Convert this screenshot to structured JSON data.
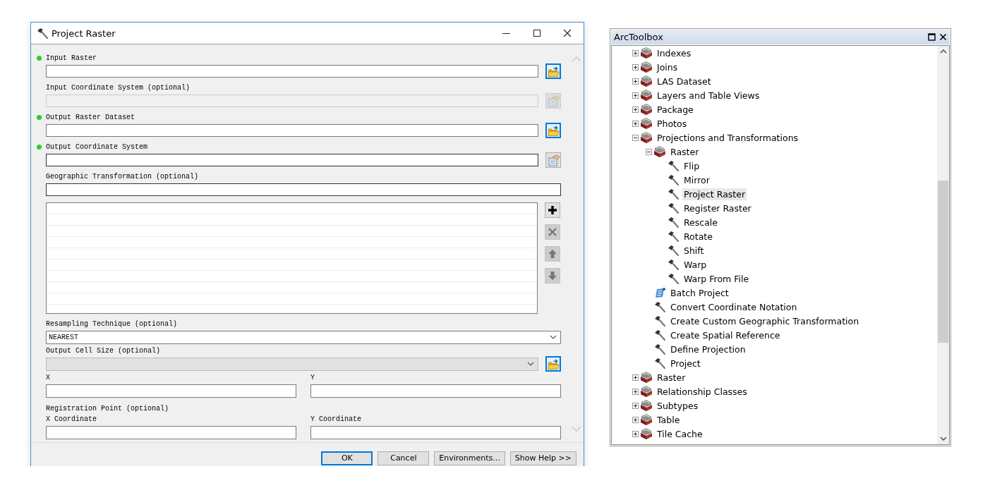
{
  "dialog": {
    "title": "Project Raster",
    "params": [
      {
        "kind": "field",
        "label": "Input Raster",
        "required": true,
        "disabled": false,
        "button": {
          "kind": "browse",
          "disabled": false
        }
      },
      {
        "kind": "field",
        "label": "Input Coordinate System (optional)",
        "required": false,
        "disabled": true,
        "button": {
          "kind": "properties",
          "disabled": true
        }
      },
      {
        "kind": "field",
        "label": "Output Raster Dataset",
        "required": true,
        "disabled": false,
        "button": {
          "kind": "browse",
          "disabled": false
        }
      },
      {
        "kind": "field",
        "label": "Output Coordinate System",
        "required": true,
        "disabled": false,
        "button": {
          "kind": "properties",
          "disabled": false
        }
      },
      {
        "kind": "list",
        "label": "Geographic Transformation (optional)",
        "required": false,
        "disabled": false,
        "list_buttons": [
          {
            "kind": "add",
            "disabled": false
          },
          {
            "kind": "remove",
            "disabled": true
          },
          {
            "kind": "up",
            "disabled": true
          },
          {
            "kind": "down",
            "disabled": true
          }
        ]
      },
      {
        "kind": "dropdown",
        "label": "Resampling Technique (optional)",
        "required": false,
        "disabled": false,
        "value": "NEAREST"
      },
      {
        "kind": "dropdown",
        "label": "Output Cell Size (optional)",
        "required": false,
        "disabled": true,
        "button": {
          "kind": "browse",
          "disabled": false
        }
      },
      {
        "kind": "pair",
        "fields": [
          {
            "label": "X"
          },
          {
            "label": "Y"
          }
        ]
      },
      {
        "kind": "heading",
        "label": "Registration Point (optional)"
      },
      {
        "kind": "pair",
        "fields": [
          {
            "label": "X Coordinate"
          },
          {
            "label": "Y Coordinate"
          }
        ]
      }
    ],
    "buttons": [
      {
        "label": "OK",
        "focused": true
      },
      {
        "label": "Cancel",
        "focused": false
      },
      {
        "label": "Environments...",
        "focused": false
      },
      {
        "label": "Show Help >>",
        "focused": false
      }
    ]
  },
  "toolbox": {
    "title": "ArcToolbox",
    "items": [
      {
        "kind": "toolset",
        "label": "Indexes",
        "expanded": false,
        "selected": false
      },
      {
        "kind": "toolset",
        "label": "Joins",
        "expanded": false,
        "selected": false
      },
      {
        "kind": "toolset",
        "label": "LAS Dataset",
        "expanded": false,
        "selected": false
      },
      {
        "kind": "toolset",
        "label": "Layers and Table Views",
        "expanded": false,
        "selected": false
      },
      {
        "kind": "toolset",
        "label": "Package",
        "expanded": false,
        "selected": false
      },
      {
        "kind": "toolset",
        "label": "Photos",
        "expanded": false,
        "selected": false
      },
      {
        "kind": "toolset",
        "label": "Projections and Transformations",
        "expanded": true,
        "selected": false,
        "children": [
          {
            "kind": "toolset",
            "label": "Raster",
            "expanded": true,
            "selected": false,
            "children": [
              {
                "kind": "tool",
                "label": "Flip",
                "selected": false
              },
              {
                "kind": "tool",
                "label": "Mirror",
                "selected": false
              },
              {
                "kind": "tool",
                "label": "Project Raster",
                "selected": true
              },
              {
                "kind": "tool",
                "label": "Register Raster",
                "selected": false
              },
              {
                "kind": "tool",
                "label": "Rescale",
                "selected": false
              },
              {
                "kind": "tool",
                "label": "Rotate",
                "selected": false
              },
              {
                "kind": "tool",
                "label": "Shift",
                "selected": false
              },
              {
                "kind": "tool",
                "label": "Warp",
                "selected": false
              },
              {
                "kind": "tool",
                "label": "Warp From File",
                "selected": false
              }
            ]
          },
          {
            "kind": "script",
            "label": "Batch Project",
            "selected": false
          },
          {
            "kind": "tool",
            "label": "Convert Coordinate Notation",
            "selected": false
          },
          {
            "kind": "tool",
            "label": "Create Custom Geographic Transformation",
            "selected": false
          },
          {
            "kind": "tool",
            "label": "Create Spatial Reference",
            "selected": false
          },
          {
            "kind": "tool",
            "label": "Define Projection",
            "selected": false
          },
          {
            "kind": "tool",
            "label": "Project",
            "selected": false
          }
        ]
      },
      {
        "kind": "toolset",
        "label": "Raster",
        "expanded": false,
        "selected": false
      },
      {
        "kind": "toolset",
        "label": "Relationship Classes",
        "expanded": false,
        "selected": false
      },
      {
        "kind": "toolset",
        "label": "Subtypes",
        "expanded": false,
        "selected": false
      },
      {
        "kind": "toolset",
        "label": "Table",
        "expanded": false,
        "selected": false
      },
      {
        "kind": "toolset",
        "label": "Tile Cache",
        "expanded": false,
        "selected": false
      }
    ]
  }
}
